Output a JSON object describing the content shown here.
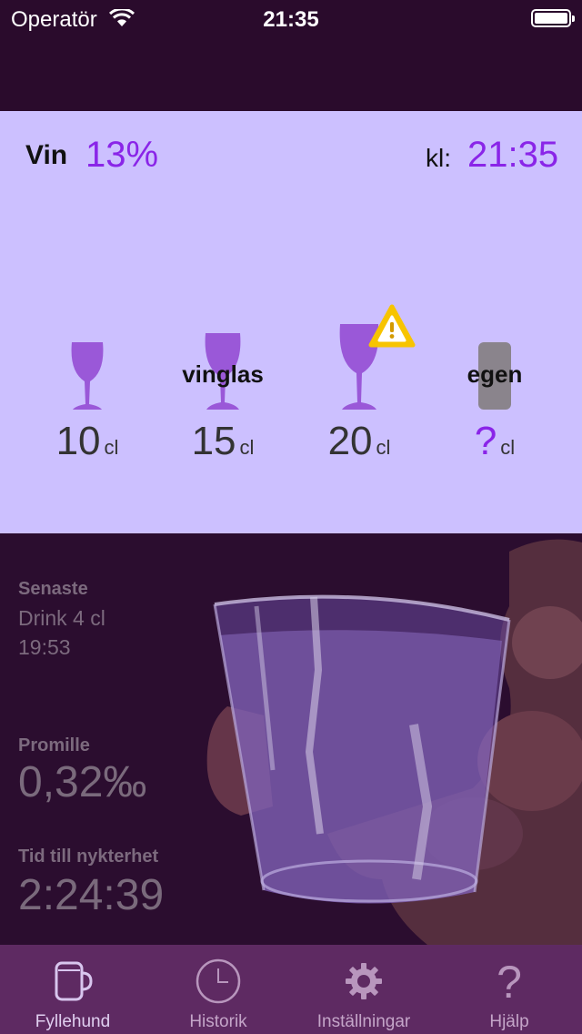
{
  "status_bar": {
    "carrier": "Operatör",
    "time": "21:35"
  },
  "header": {
    "drink_type": "Vin",
    "abv": "13%",
    "time_label": "kl:",
    "time_value": "21:35"
  },
  "options": [
    {
      "label": "",
      "size": "10",
      "unit": "cl"
    },
    {
      "label": "vinglas",
      "size": "15",
      "unit": "cl"
    },
    {
      "label": "",
      "size": "20",
      "unit": "cl",
      "warning": true
    },
    {
      "label": "egen",
      "size": "?",
      "unit": "cl"
    }
  ],
  "stats": {
    "latest_title": "Senaste",
    "latest_drink": "Drink 4 cl",
    "latest_time": "19:53",
    "promille_title": "Promille",
    "promille_value": "0,32‰",
    "sober_title": "Tid till nykterhet",
    "sober_value": "2:24:39"
  },
  "tabs": [
    {
      "label": "Fyllehund",
      "icon": "beer-mug-icon",
      "active": true
    },
    {
      "label": "Historik",
      "icon": "clock-icon",
      "active": false
    },
    {
      "label": "Inställningar",
      "icon": "gear-icon",
      "active": false
    },
    {
      "label": "Hjälp",
      "icon": "question-icon",
      "active": false
    }
  ],
  "colors": {
    "accent": "#8a25e8",
    "panel": "#ccc0ff",
    "tab_bar": "#5e2a62",
    "background": "#2a0b2c"
  }
}
